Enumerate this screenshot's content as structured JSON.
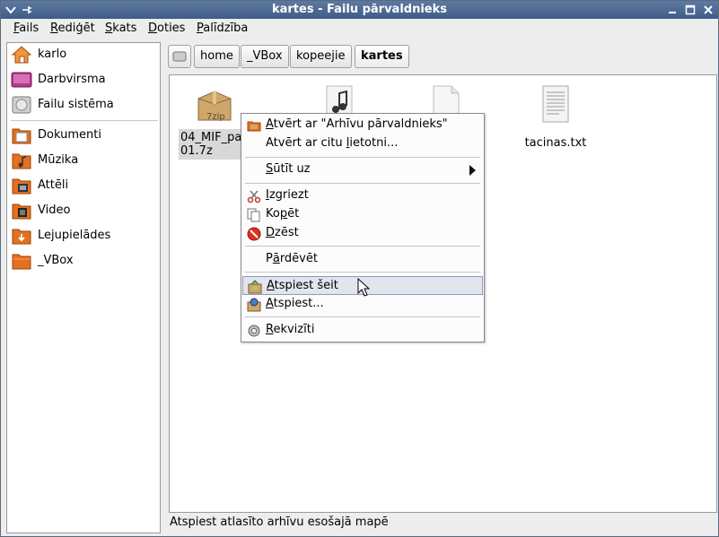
{
  "window": {
    "title": "kartes - Failu pārvaldnieks"
  },
  "menubar": {
    "items": [
      {
        "label": "Fails",
        "u": "F",
        "rest": "ails"
      },
      {
        "label": "Rediģēt",
        "u": "R",
        "rest": "ediģēt"
      },
      {
        "label": "Skats",
        "u": "S",
        "rest": "kats"
      },
      {
        "label": "Doties",
        "u": "D",
        "rest": "oties"
      },
      {
        "label": "Palīdzība",
        "u": "P",
        "rest": "alīdzība"
      }
    ]
  },
  "sidebar": {
    "items": [
      {
        "label": "karlo",
        "icon": "home-icon"
      },
      {
        "label": "Darbvirsma",
        "icon": "desktop-icon"
      },
      {
        "label": "Failu sistēma",
        "icon": "harddisk-icon"
      },
      {
        "label": "Dokumenti",
        "icon": "folder-documents-icon"
      },
      {
        "label": "Mūzika",
        "icon": "folder-music-icon"
      },
      {
        "label": "Attēli",
        "icon": "folder-pictures-icon"
      },
      {
        "label": "Video",
        "icon": "folder-video-icon"
      },
      {
        "label": "Lejupielādes",
        "icon": "folder-downloads-icon"
      },
      {
        "label": "_VBox",
        "icon": "folder-icon"
      }
    ]
  },
  "pathbar": {
    "crumbs": [
      "home",
      "_VBox",
      "kopeejie",
      "kartes"
    ],
    "active": "kartes"
  },
  "files": [
    {
      "name_line1": "04_MIF_pa",
      "name_line2": "01.7z",
      "badge": "7zip",
      "icon": "archive-7zip-icon",
      "selected": true
    },
    {
      "name": "",
      "icon": "music-file-icon"
    },
    {
      "name": "",
      "icon": "blank-file-icon"
    },
    {
      "name": "tacinas.txt",
      "icon": "text-file-icon"
    }
  ],
  "context_menu": {
    "items": [
      {
        "u": "A",
        "rest": "tvērt ar \"Arhīvu pārvaldnieks\"",
        "icon": "archive-manager-icon"
      },
      {
        "pre": "Atvērt ar citu ",
        "u": "l",
        "rest": "ietotni...",
        "icon": ""
      },
      {
        "pre": "",
        "u": "S",
        "rest": "ūtīt uz",
        "icon": "",
        "submenu": true
      },
      {
        "pre": "",
        "u": "I",
        "rest": "zgriezt",
        "icon": "scissors-icon"
      },
      {
        "pre": "Ko",
        "u": "p",
        "rest": "ēt",
        "icon": "copy-icon"
      },
      {
        "pre": "",
        "u": "D",
        "rest": "zēst",
        "icon": "delete-icon"
      },
      {
        "pre": "P",
        "u": "ā",
        "rest": "rdēvēt",
        "icon": ""
      },
      {
        "pre": "",
        "u": "A",
        "rest": "tspiest šeit",
        "icon": "extract-here-icon",
        "highlighted": true
      },
      {
        "pre": "",
        "u": "A",
        "rest": "tspiest...",
        "icon": "extract-icon"
      },
      {
        "pre": "",
        "u": "R",
        "rest": "ekvizīti",
        "icon": "properties-icon"
      }
    ]
  },
  "statusbar": {
    "text": "Atspiest atlasīto arhīvu esošajā mapē"
  },
  "colors": {
    "titlebar": "#4a6794",
    "highlight": "#e1e5ee",
    "folder": "#e4711f"
  }
}
